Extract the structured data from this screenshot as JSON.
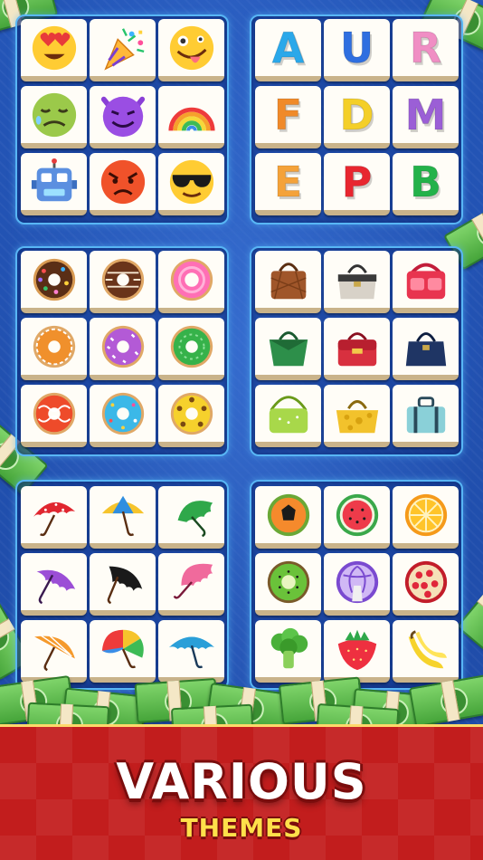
{
  "banner": {
    "title": "VARIOUS",
    "subtitle": "THEMES"
  },
  "themes": [
    {
      "name": "emoji",
      "tiles": [
        "heart-eyes-face-icon",
        "party-popper-icon",
        "crazy-face-icon",
        "nauseated-face-icon",
        "smiling-devil-icon",
        "rainbow-icon",
        "robot-icon",
        "angry-face-icon",
        "sunglasses-face-icon"
      ]
    },
    {
      "name": "letters",
      "tiles": [
        "A",
        "U",
        "R",
        "F",
        "D",
        "M",
        "E",
        "P",
        "B"
      ],
      "colors": [
        "#2aa8ea",
        "#2f6fe0",
        "#f08ec4",
        "#f08a2a",
        "#f4cf28",
        "#9b5fd6",
        "#f4a23a",
        "#e8262f",
        "#23b24a"
      ]
    },
    {
      "name": "donuts",
      "tiles": [
        "sprinkle-chocolate-donut-icon",
        "chocolate-stripe-donut-icon",
        "pink-donut-icon",
        "orange-glaze-donut-icon",
        "purple-sprinkle-donut-icon",
        "green-donut-icon",
        "red-drizzle-donut-icon",
        "blue-sprinkle-donut-icon",
        "yellow-flower-donut-icon"
      ]
    },
    {
      "name": "handbags",
      "tiles": [
        "brown-quilted-bag-icon",
        "gray-bag-icon",
        "red-pink-bag-icon",
        "green-tote-bag-icon",
        "red-satchel-bag-icon",
        "navy-handbag-icon",
        "lime-shoulder-bag-icon",
        "yellow-spotted-bag-icon",
        "teal-suitcase-bag-icon"
      ]
    },
    {
      "name": "umbrellas",
      "tiles": [
        "red-polka-umbrella-icon",
        "yellow-blue-umbrella-icon",
        "green-umbrella-icon",
        "purple-umbrella-icon",
        "black-umbrella-icon",
        "pink-umbrella-icon",
        "orange-umbrella-icon",
        "rainbow-umbrella-icon",
        "teal-umbrella-icon"
      ]
    },
    {
      "name": "fruits",
      "tiles": [
        "papaya-icon",
        "watermelon-icon",
        "orange-slice-icon",
        "kiwi-icon",
        "purple-cabbage-icon",
        "pomegranate-icon",
        "broccoli-icon",
        "strawberry-icon",
        "banana-icon"
      ]
    }
  ]
}
